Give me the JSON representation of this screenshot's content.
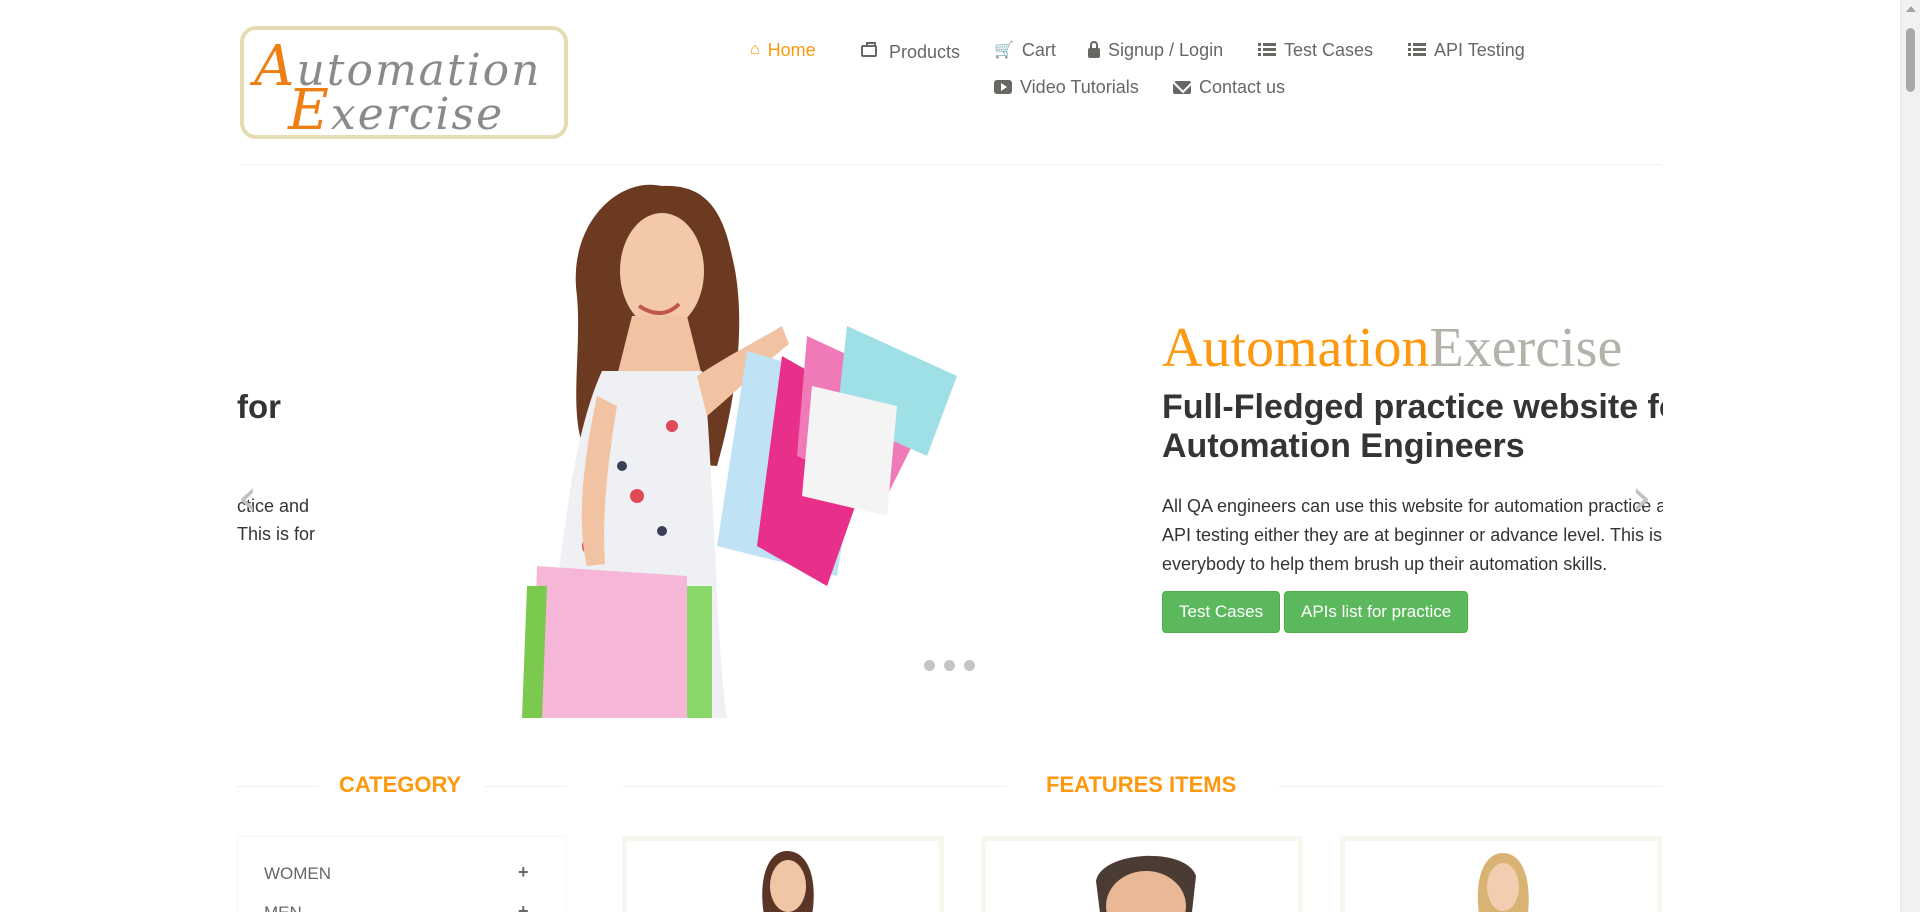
{
  "logo": {
    "line1_cap": "A",
    "line1_rest": "utomation",
    "line2_cap": "E",
    "line2_rest": "xercise"
  },
  "nav": {
    "home": "Home",
    "products": "Products",
    "cart": "Cart",
    "login": "Signup / Login",
    "test_cases": "Test Cases",
    "api_testing": "API Testing",
    "video_tutorials": "Video Tutorials",
    "contact": "Contact us"
  },
  "slider": {
    "partial_heading": "for",
    "partial_text_1": "ctice and",
    "partial_text_2": "This is for",
    "brand_part1": "Automation",
    "brand_part2": "Exercise",
    "heading_line1": "Full-Fledged practice website for",
    "heading_line2": "Automation Engineers",
    "text_line1": "All QA engineers can use this website for automation practice and",
    "text_line2": "API testing either they are at beginner or advance level. This is for",
    "text_line3": "everybody to help them brush up their automation skills.",
    "btn_test_cases": "Test Cases",
    "btn_apis": "APIs list for practice",
    "prev_arrow": "‹",
    "next_arrow": "›",
    "slide_count": 3
  },
  "category": {
    "title": "Category",
    "items": [
      {
        "label": "Women",
        "toggle": "+"
      },
      {
        "label": "Men",
        "toggle": "+"
      }
    ]
  },
  "features": {
    "title": "Features Items"
  },
  "colors": {
    "accent": "#fe980f",
    "button": "#5cb85c",
    "text_dark": "#363432",
    "text": "#696763"
  }
}
